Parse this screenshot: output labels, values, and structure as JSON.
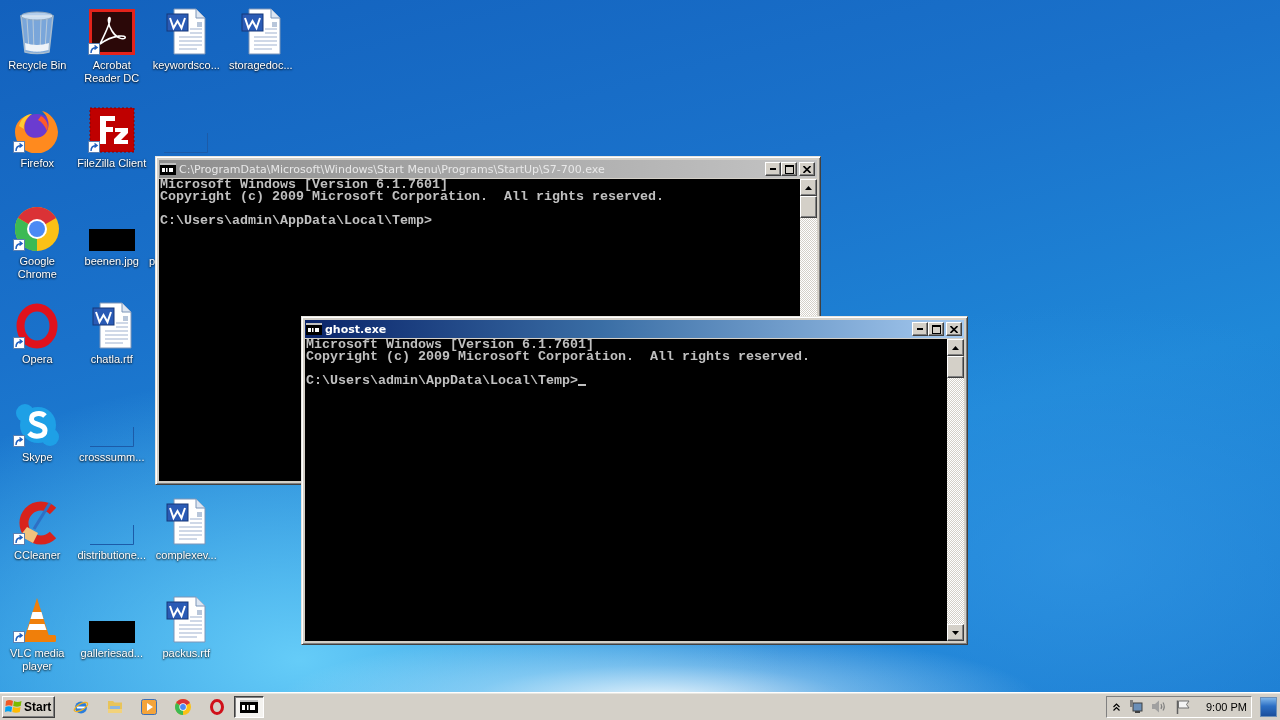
{
  "desktop": {
    "icon_rows": [
      [
        {
          "label": "Recycle Bin",
          "kind": "bin",
          "shortcut": false
        },
        {
          "label": "Acrobat Reader DC",
          "kind": "pdf",
          "shortcut": true
        },
        {
          "label": "keywordsco...",
          "kind": "doc",
          "shortcut": false
        },
        {
          "label": "storagedoc...",
          "kind": "doc",
          "shortcut": false
        }
      ],
      [
        {
          "label": "Firefox",
          "kind": "fox",
          "shortcut": true
        },
        {
          "label": "FileZilla Client",
          "kind": "fz",
          "shortcut": true
        },
        {
          "kind": "blank",
          "shortcut": false
        }
      ],
      [
        {
          "label": "Google Chrome",
          "kind": "chrome",
          "shortcut": true
        },
        {
          "label": "beenen.jpg",
          "kind": "image",
          "shortcut": false
        },
        {
          "label": "p",
          "kind": "covered"
        }
      ],
      [
        {
          "label": "Opera",
          "kind": "opera",
          "shortcut": true
        },
        {
          "label": "chatla.rtf",
          "kind": "doc",
          "shortcut": false
        }
      ],
      [
        {
          "label": "Skype",
          "kind": "skype",
          "shortcut": true
        },
        {
          "label": "crosssumm...",
          "kind": "blank",
          "shortcut": false
        }
      ],
      [
        {
          "label": "CCleaner",
          "kind": "cleaner",
          "shortcut": true
        },
        {
          "label": "distributione...",
          "kind": "blank",
          "shortcut": false
        },
        {
          "label": "complexev...",
          "kind": "doc",
          "shortcut": false
        }
      ],
      [
        {
          "label": "VLC media player",
          "kind": "cone",
          "shortcut": true
        },
        {
          "label": "galleriesad...",
          "kind": "image",
          "shortcut": false
        },
        {
          "label": "packus.rtf",
          "kind": "doc",
          "shortcut": false
        }
      ]
    ]
  },
  "windows": [
    {
      "title": "C:\\ProgramData\\Microsoft\\Windows\\Start Menu\\Programs\\StartUp\\S7-700.exe",
      "active": false,
      "lines": [
        "Microsoft Windows [Version 6.1.7601]",
        "Copyright (c) 2009 Microsoft Corporation.  All rights reserved."
      ],
      "prompt": "C:\\Users\\admin\\AppData\\Local\\Temp>",
      "cursor": false
    },
    {
      "title": "ghost.exe",
      "active": true,
      "lines": [
        "Microsoft Windows [Version 6.1.7601]",
        "Copyright (c) 2009 Microsoft Corporation.  All rights reserved."
      ],
      "prompt": "C:\\Users\\admin\\AppData\\Local\\Temp>",
      "cursor": true
    }
  ],
  "taskbar": {
    "start_label": "Start",
    "task_button": {
      "selected": true
    },
    "clock": "9:00 PM"
  }
}
